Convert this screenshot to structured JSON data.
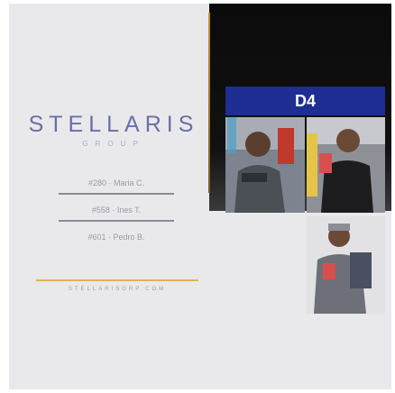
{
  "brand": {
    "name": "STELLARIS",
    "subtitle": "GROUP"
  },
  "entries": [
    {
      "label": "#280 · Maria C."
    },
    {
      "label": "#558 · Ines T."
    },
    {
      "label": "#601 · Pedro B."
    }
  ],
  "footer": {
    "website": "STELLARISGRP.COM"
  },
  "banner": {
    "code": "D4"
  },
  "colors": {
    "brand": "#6c6fa6",
    "accent_gold": "#e3b44c",
    "banner_blue": "#1e2e92",
    "dark_bg": "#0b0b0b"
  },
  "icons": {
    "photo_1": "person-photo",
    "photo_2": "person-photo",
    "photo_3": "person-photo"
  }
}
